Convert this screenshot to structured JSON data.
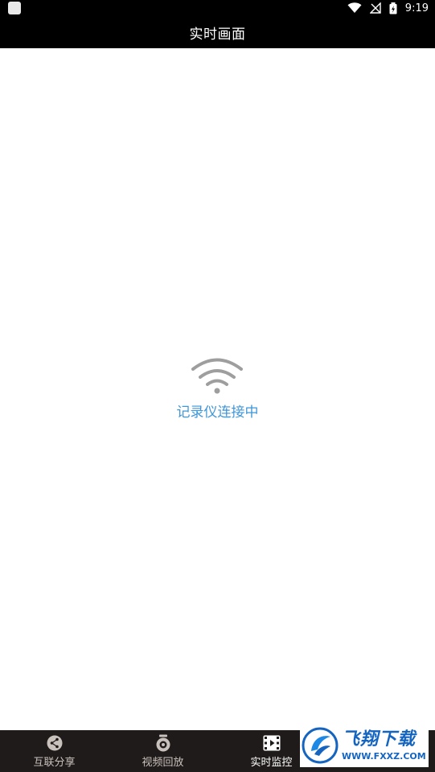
{
  "status_bar": {
    "time": "9:19",
    "icons": [
      "app-notification-icon",
      "wifi-icon",
      "no-signal-icon",
      "battery-charging-icon"
    ]
  },
  "header": {
    "title": "实时画面"
  },
  "main": {
    "status_icon": "wifi-icon",
    "connecting_text": "记录仪连接中",
    "accent_color": "#3f96d8"
  },
  "bottom_nav": {
    "items": [
      {
        "label": "互联分享",
        "icon": "share-icon",
        "active": false
      },
      {
        "label": "视频回放",
        "icon": "camera-icon",
        "active": false
      },
      {
        "label": "实时监控",
        "icon": "film-icon",
        "active": true
      }
    ]
  },
  "watermark": {
    "title": "飞翔下载",
    "url": "WWW.FXXZ.COM"
  }
}
